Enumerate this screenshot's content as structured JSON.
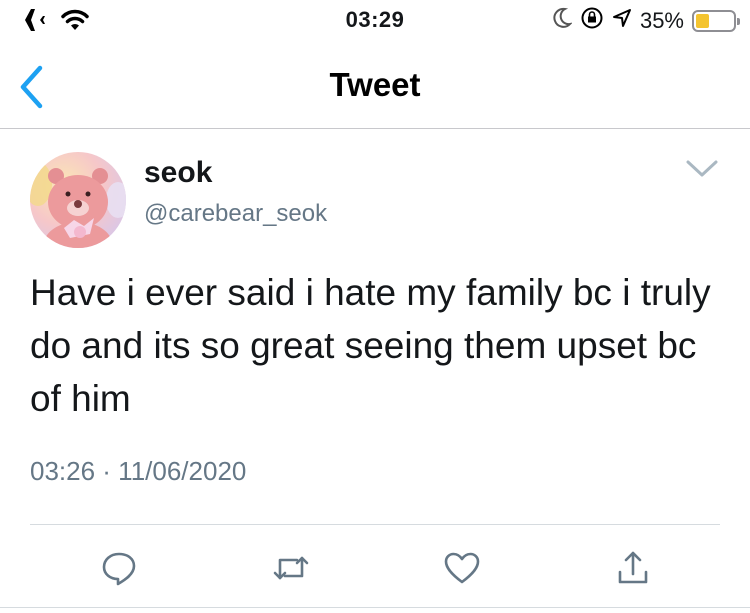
{
  "status_bar": {
    "time": "03:29",
    "battery_percent_label": "35%",
    "battery_level": 0.35,
    "icons": [
      "airplane-icon",
      "wifi-icon",
      "moon-icon",
      "orientation-lock-icon",
      "location-icon",
      "battery-icon"
    ]
  },
  "nav": {
    "title": "Tweet",
    "back_icon": "chevron-left-icon"
  },
  "tweet": {
    "display_name": "seok",
    "handle": "@carebear_seok",
    "text": "Have i ever said i hate my family bc i truly do and its so great seeing them upset bc of him",
    "timestamp": "03:26 · 11/06/2020",
    "more_icon": "chevron-down-icon"
  },
  "actions": [
    {
      "name": "reply",
      "icon": "reply-icon"
    },
    {
      "name": "retweet",
      "icon": "retweet-icon"
    },
    {
      "name": "like",
      "icon": "heart-icon"
    },
    {
      "name": "share",
      "icon": "share-icon"
    }
  ],
  "colors": {
    "accent": "#1da1f2",
    "secondary_text": "#657786",
    "battery_fill": "#f4c430"
  }
}
